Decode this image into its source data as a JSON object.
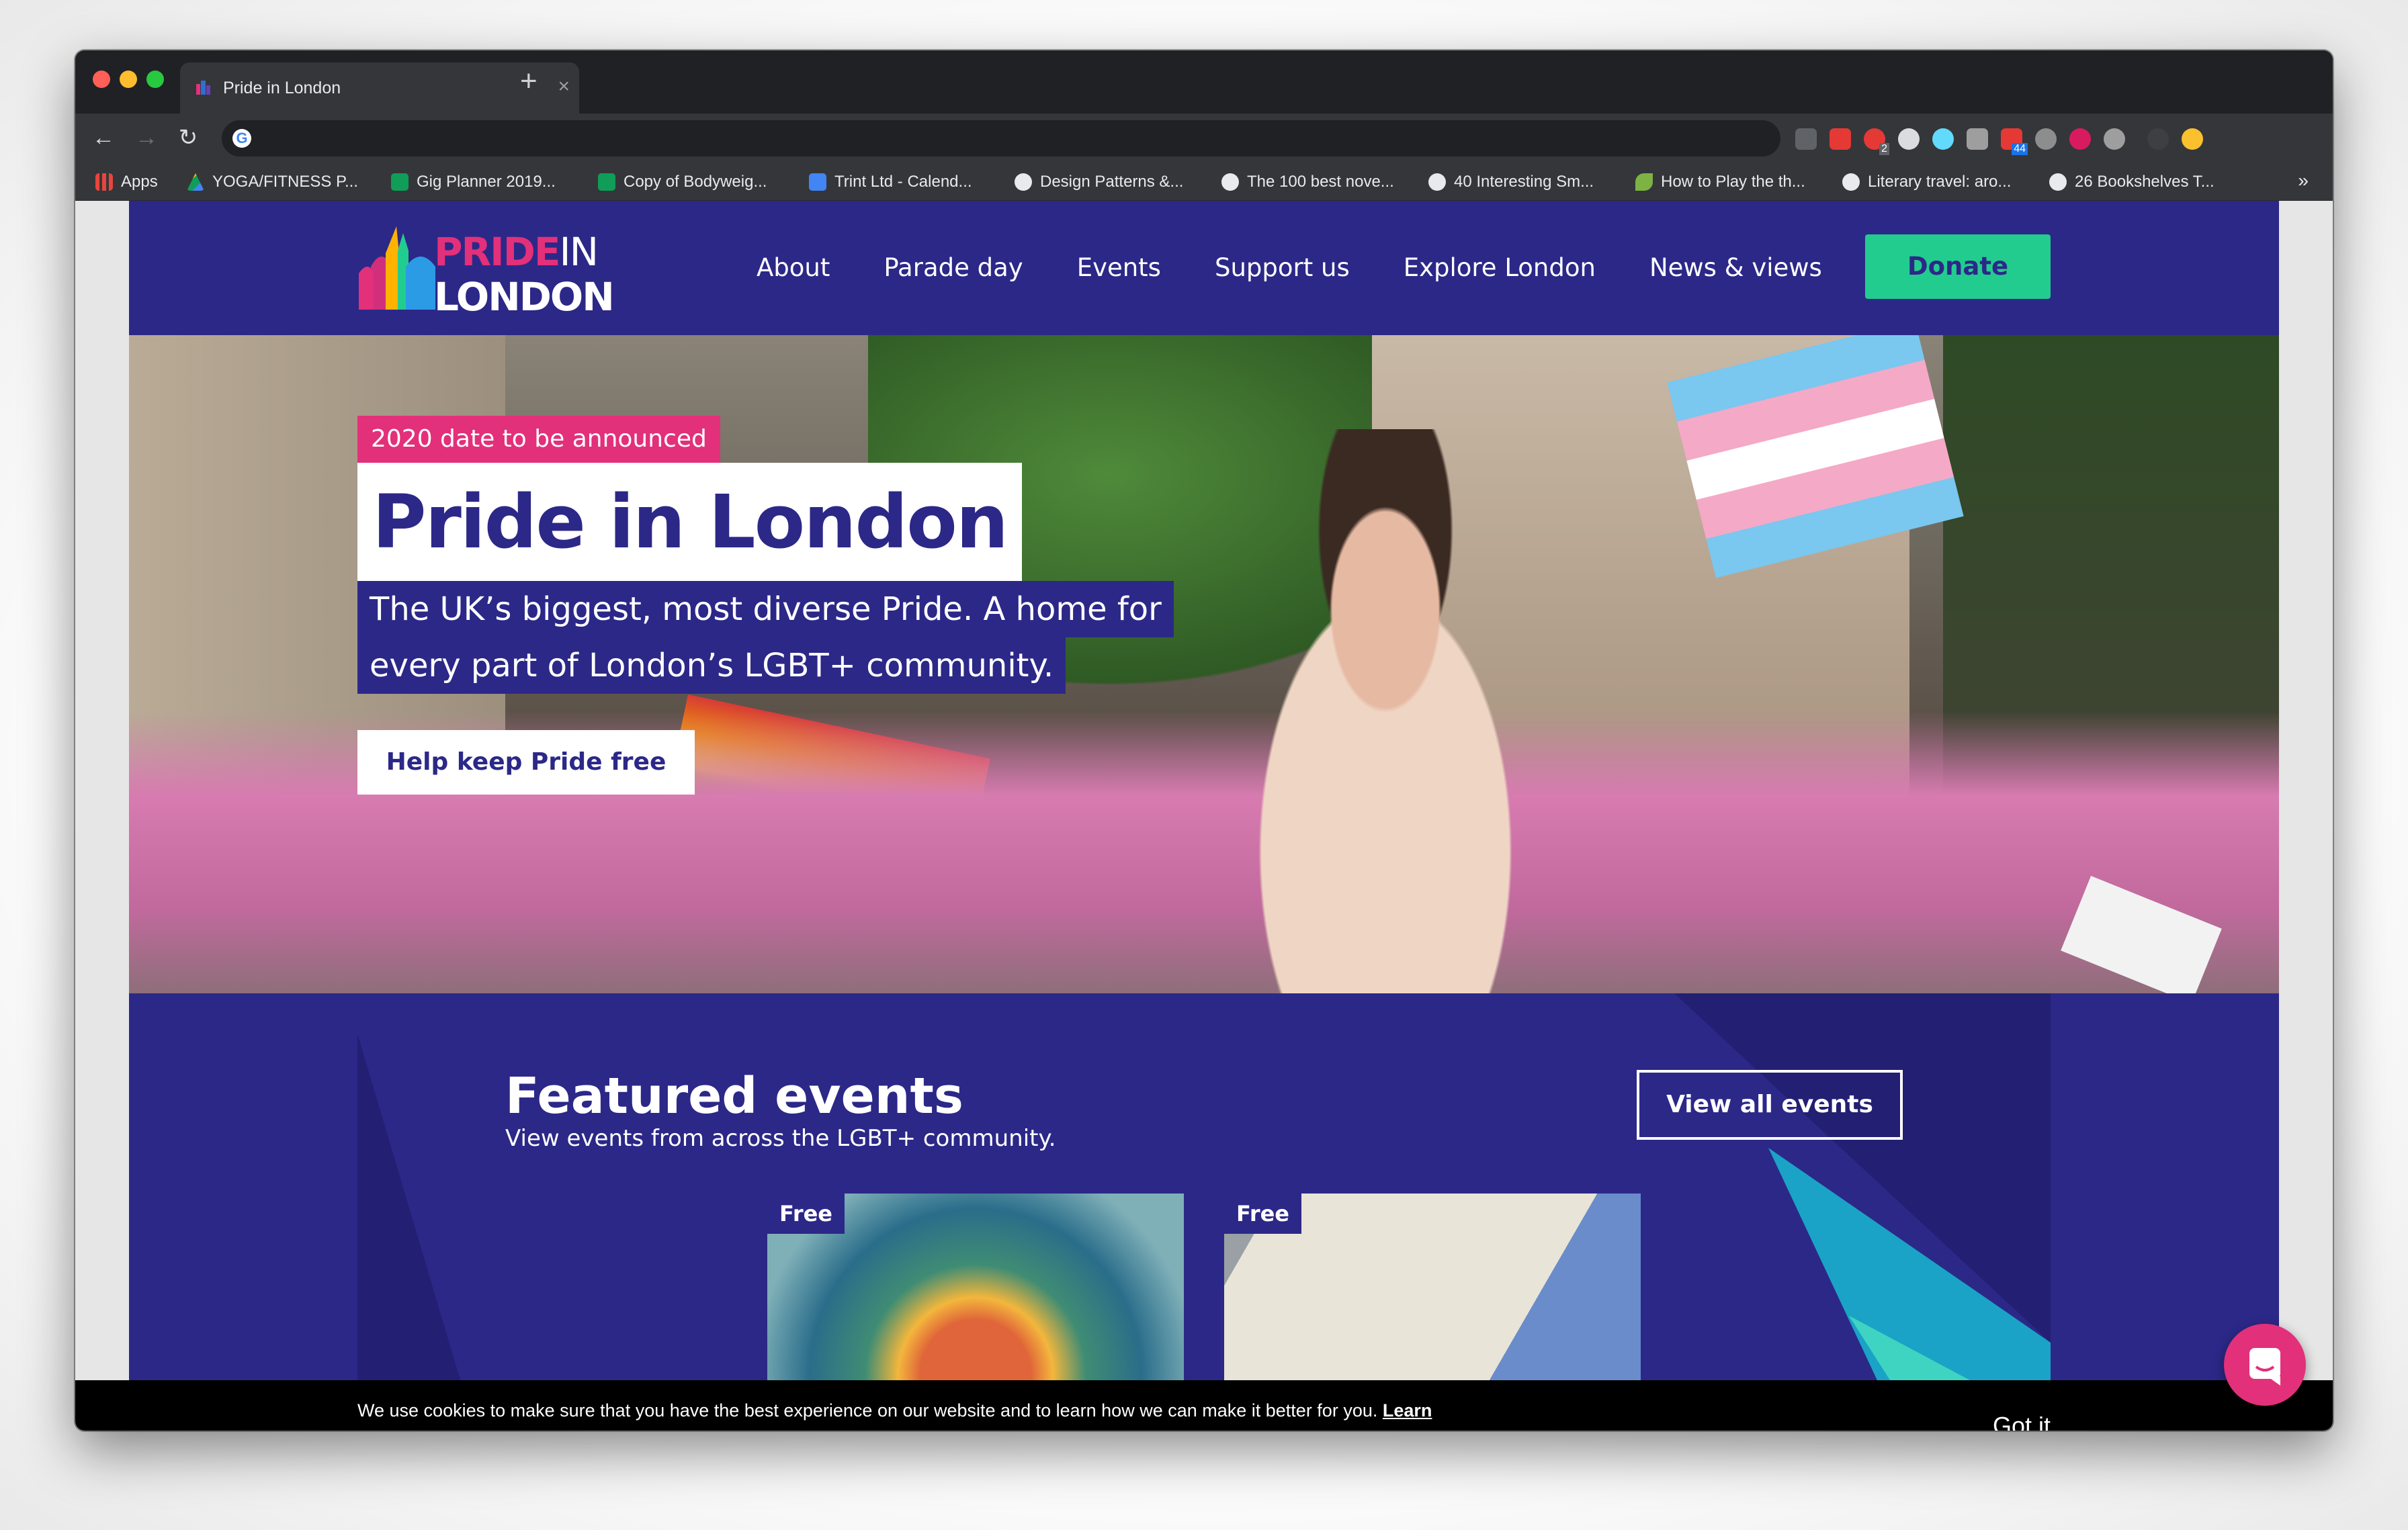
{
  "browser": {
    "tab_title": "Pride in London",
    "tab_close": "×",
    "new_tab": "+",
    "nav": {
      "back": "←",
      "forward": "→",
      "reload": "↻"
    },
    "omnibox_icon": "G",
    "bookmarks": [
      {
        "label": "Apps",
        "icon": "apps-grid-icon",
        "color": "#e8453c"
      },
      {
        "label": "YOGA/FITNESS P...",
        "icon": "google-drive-icon",
        "color": "#fbbc04"
      },
      {
        "label": "Gig Planner 2019...",
        "icon": "google-sheets-icon",
        "color": "#0f9d58"
      },
      {
        "label": "Copy of Bodyweig...",
        "icon": "google-sheets-icon",
        "color": "#0f9d58"
      },
      {
        "label": "Trint Ltd - Calend...",
        "icon": "calendar-icon",
        "color": "#4285f4"
      },
      {
        "label": "Design Patterns &...",
        "icon": "globe-icon",
        "color": "#e8eaed"
      },
      {
        "label": "The 100 best nove...",
        "icon": "globe-icon",
        "color": "#e8eaed"
      },
      {
        "label": "40 Interesting Sm...",
        "icon": "globe-icon",
        "color": "#e8eaed"
      },
      {
        "label": "How to Play the th...",
        "icon": "leaf-icon",
        "color": "#7cb342"
      },
      {
        "label": "Literary travel: aro...",
        "icon": "globe-icon",
        "color": "#e8eaed"
      },
      {
        "label": "26 Bookshelves T...",
        "icon": "globe-icon",
        "color": "#e8eaed"
      }
    ],
    "bookmarks_more": "»",
    "extension_badges": [
      "2",
      "44"
    ]
  },
  "site": {
    "colors": {
      "brand_navy": "#2c2888",
      "brand_pink": "#e3307a",
      "brand_green": "#22cc8f"
    },
    "logo": {
      "pride": "PRIDE",
      "in": "IN",
      "london": "LONDON"
    },
    "nav": [
      "About",
      "Parade day",
      "Events",
      "Support us",
      "Explore London",
      "News & views"
    ],
    "donate_label": "Donate",
    "hero": {
      "date_tag": "2020 date to be announced",
      "title": "Pride in London",
      "subtitle_lines": [
        "The UK’s biggest, most diverse Pride. A home for",
        "every part of London’s LGBT+ community."
      ],
      "cta": "Help keep Pride free"
    },
    "featured": {
      "title": "Featured events",
      "subtitle": "View events from across the LGBT+ community.",
      "view_all": "View all events",
      "cards": [
        {
          "tag": "Free"
        },
        {
          "tag": "Free"
        }
      ]
    },
    "cookie": {
      "text": "We use cookies to make sure that you have the best experience on our website and to learn how we can make it better for you.",
      "learn_more": "Learn more",
      "accept": "Got it"
    }
  }
}
